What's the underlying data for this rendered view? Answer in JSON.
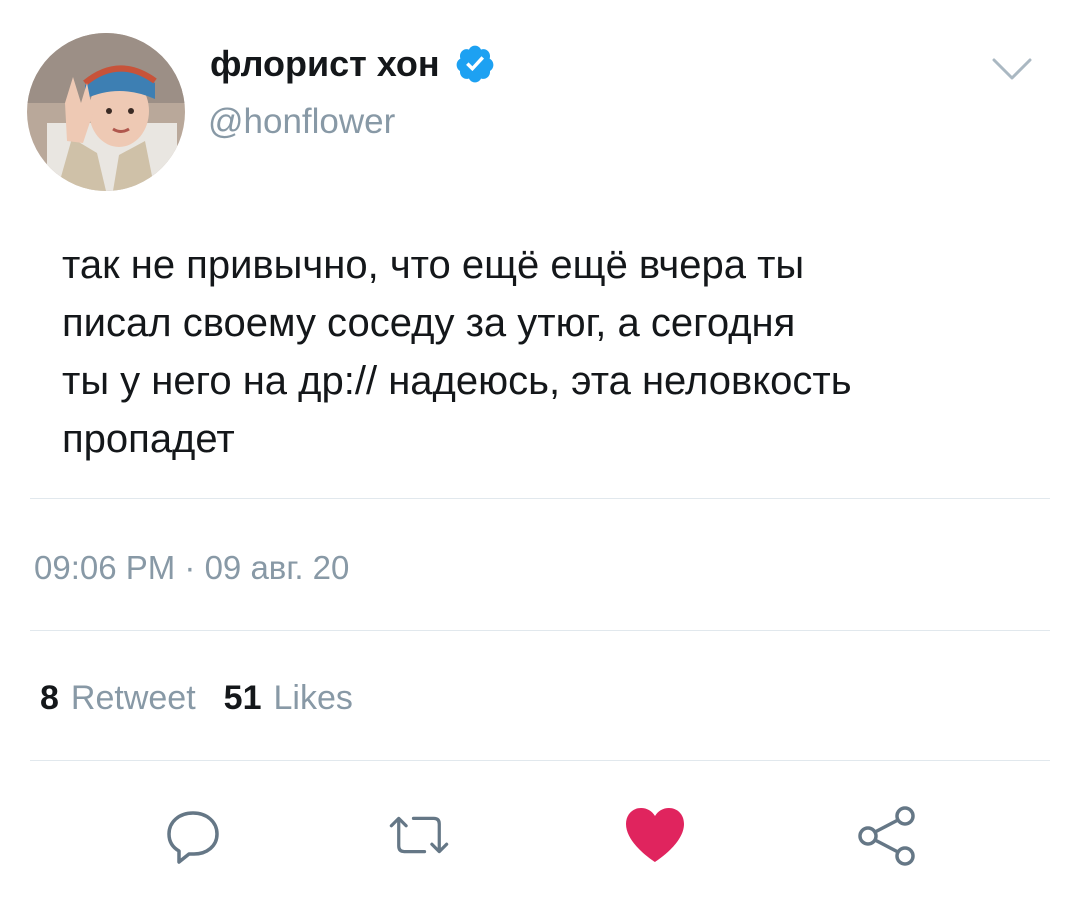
{
  "user": {
    "display_name": "флорист хон",
    "handle": "@honflower",
    "verified": true,
    "avatar_icon": "profile-photo"
  },
  "tweet": {
    "lines": [
      "так не привычно, что ещё ещё вчера ты",
      "писал своему соседу за утюг, а сегодня",
      "ты у него на др:// надеюсь, эта неловкость",
      "пропадет"
    ],
    "timestamp": "09:06 PM · 09 авг. 20"
  },
  "stats": {
    "retweets_count": "8",
    "retweets_label": "Retweet",
    "likes_count": "51",
    "likes_label": "Likes"
  },
  "actions": {
    "reply_icon": "reply-icon",
    "retweet_icon": "retweet-icon",
    "like_icon": "heart-icon",
    "share_icon": "share-icon"
  },
  "colors": {
    "verified_blue": "#1da1f2",
    "like_red": "#e0245e",
    "muted_gray": "#8899a6",
    "icon_gray": "#657786"
  }
}
